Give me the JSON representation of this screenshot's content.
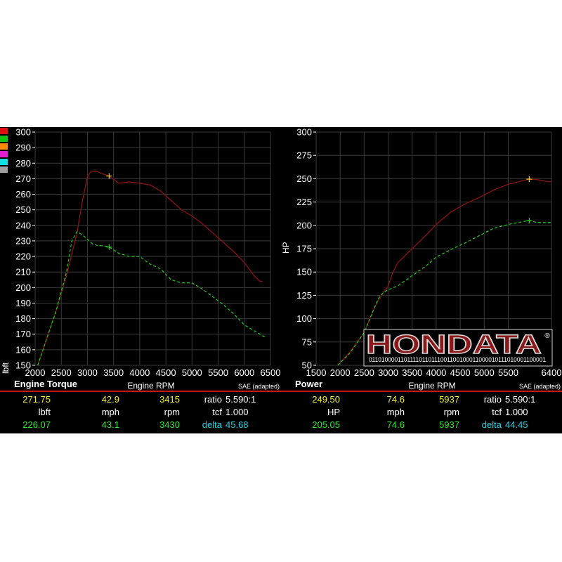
{
  "legend_swatches": [
    "#e01010",
    "#15c015",
    "#ff8a00",
    "#e020d0",
    "#10e0e0",
    "#a0a0a0"
  ],
  "series_colors": {
    "run1": "#8a1212",
    "run2": "#1fbf1f"
  },
  "chart_data": [
    {
      "type": "line",
      "title": "Engine Torque",
      "xlabel": "Engine RPM",
      "ylabel": "lbft",
      "note": "SAE (adapted)",
      "xlim": [
        2000,
        6500
      ],
      "ylim": [
        150,
        300
      ],
      "xticks": [
        2000,
        2500,
        3000,
        3500,
        4000,
        4500,
        5000,
        5500,
        6000,
        6500
      ],
      "yticks": [
        150,
        160,
        170,
        180,
        190,
        200,
        210,
        220,
        230,
        240,
        250,
        260,
        270,
        280,
        290,
        300
      ],
      "grid": true,
      "cursor_rpm": 3415,
      "series": [
        {
          "x": [
            2050,
            2200,
            2400,
            2600,
            2800,
            2900,
            3000,
            3050,
            3100,
            3200,
            3300,
            3415,
            3600,
            3800,
            4000,
            4200,
            4400,
            4600,
            4800,
            5000,
            5200,
            5400,
            5600,
            5800,
            6000,
            6200,
            6300,
            6350
          ],
          "values": [
            150,
            165,
            185,
            208,
            235,
            255,
            271,
            274,
            275,
            274.5,
            273,
            271.75,
            267,
            268,
            267,
            266,
            262,
            256,
            250,
            246,
            241,
            235,
            229,
            223,
            216,
            207,
            204,
            204
          ]
        },
        {
          "x": [
            2050,
            2200,
            2400,
            2600,
            2700,
            2800,
            2900,
            3000,
            3100,
            3200,
            3300,
            3415,
            3600,
            3800,
            4000,
            4200,
            4400,
            4600,
            4800,
            5000,
            5200,
            5400,
            5600,
            5800,
            6000,
            6200,
            6400
          ],
          "values": [
            150,
            165,
            185,
            210,
            230,
            236,
            234,
            231,
            228,
            227,
            227,
            226.07,
            222,
            220,
            220,
            215,
            212,
            205,
            203,
            203,
            199,
            194,
            189,
            183,
            176,
            172,
            168
          ]
        }
      ]
    },
    {
      "type": "line",
      "title": "Power",
      "xlabel": "Engine RPM",
      "ylabel": "HP",
      "note": "SAE (adapted)",
      "xlim": [
        1500,
        6400
      ],
      "ylim": [
        50,
        300
      ],
      "xticks": [
        1500,
        2000,
        2500,
        3000,
        3500,
        4000,
        4500,
        5000,
        5500,
        6400
      ],
      "yticks": [
        50,
        75,
        100,
        125,
        150,
        175,
        200,
        225,
        250,
        275,
        300
      ],
      "grid": true,
      "cursor_rpm": 5937,
      "series": [
        {
          "x": [
            1950,
            2200,
            2500,
            2700,
            2800,
            2900,
            3000,
            3100,
            3200,
            3500,
            3800,
            4000,
            4300,
            4600,
            4900,
            5200,
            5500,
            5800,
            5937,
            6100,
            6300,
            6400
          ],
          "values": [
            50,
            64,
            85,
            110,
            120,
            128,
            135,
            150,
            160,
            175,
            190,
            201,
            214,
            223,
            230,
            238,
            244,
            248,
            249.5,
            249,
            247,
            247
          ]
        },
        {
          "x": [
            1950,
            2200,
            2500,
            2700,
            2800,
            2900,
            3000,
            3200,
            3500,
            3800,
            4000,
            4300,
            4600,
            4900,
            5200,
            5500,
            5800,
            5937,
            6100,
            6300,
            6400
          ],
          "values": [
            50,
            63,
            85,
            110,
            122,
            128,
            131,
            135,
            146,
            157,
            166,
            174,
            181,
            189,
            197,
            201,
            204,
            205.05,
            203,
            203,
            203
          ]
        }
      ]
    }
  ],
  "readouts": {
    "torque": {
      "run1": {
        "value": "271.75",
        "speed": "42.9",
        "rpm": "3415"
      },
      "units": {
        "value": "lbft",
        "speed": "mph",
        "rpm": "rpm"
      },
      "run2": {
        "value": "226.07",
        "speed": "43.1",
        "rpm": "3430"
      },
      "ratio_label": "ratio",
      "ratio": "5.590:1",
      "tcf_label": "tcf",
      "tcf": "1.000",
      "delta_label": "delta",
      "delta": "45.68"
    },
    "power": {
      "run1": {
        "value": "249.50",
        "speed": "74.6",
        "rpm": "5937"
      },
      "units": {
        "value": "HP",
        "speed": "mph",
        "rpm": "rpm"
      },
      "run2": {
        "value": "205.05",
        "speed": "74.6",
        "rpm": "5937"
      },
      "ratio_label": "ratio",
      "ratio": "5.590:1",
      "tcf_label": "tcf",
      "tcf": "1.000",
      "delta_label": "delta",
      "delta": "44.45"
    }
  },
  "logo": {
    "text": "HONDATA",
    "registered": "®",
    "binary": "01101000011011110110111001100100011000010111010001100001"
  }
}
